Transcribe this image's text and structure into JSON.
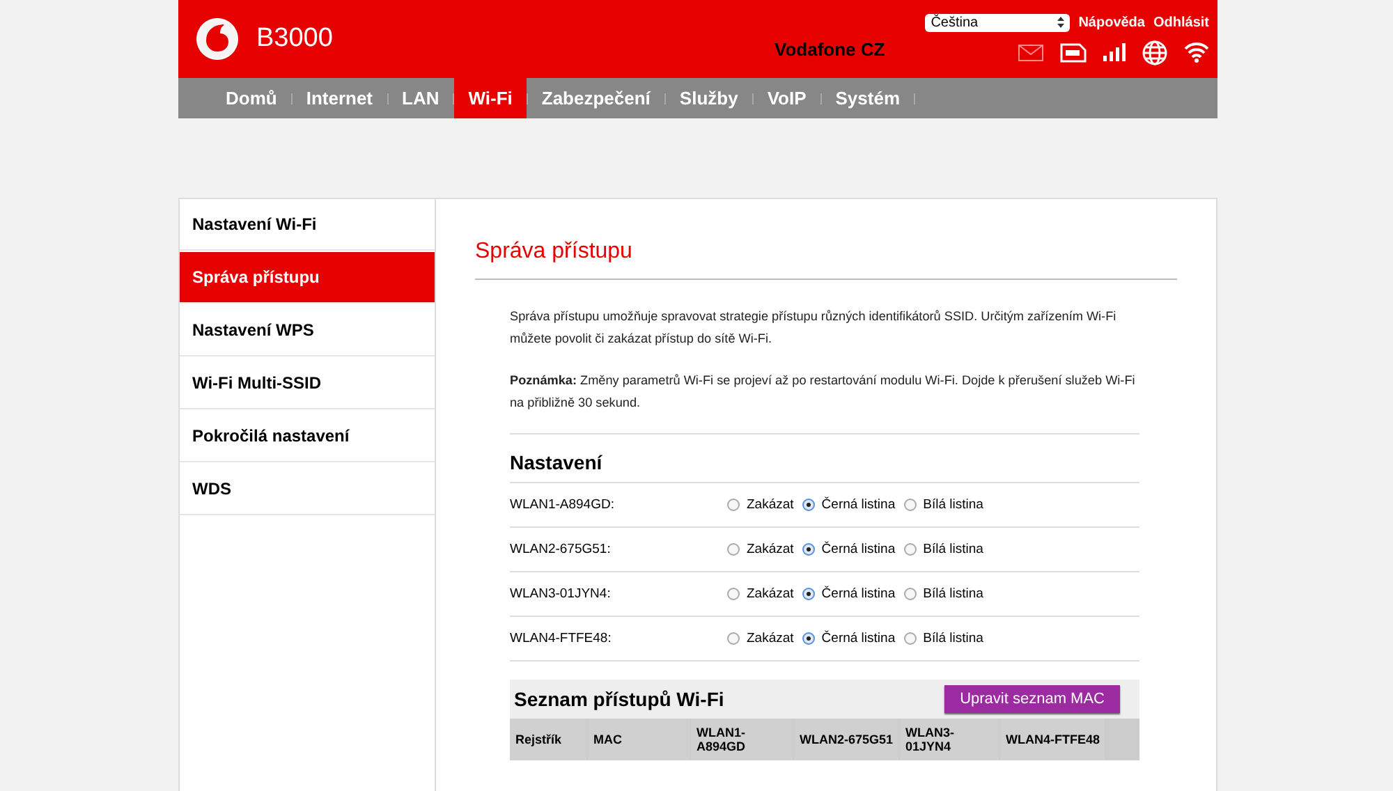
{
  "header": {
    "logo_text": "B3000",
    "language": "Čeština",
    "links": [
      "Nápověda",
      "Odhlásit"
    ],
    "operator": "Vodafone CZ"
  },
  "nav": [
    {
      "label": "Domů",
      "selected": false
    },
    {
      "label": "Internet",
      "selected": false
    },
    {
      "label": "LAN",
      "selected": false
    },
    {
      "label": "Wi-Fi",
      "selected": true
    },
    {
      "label": "Zabezpečení",
      "selected": false
    },
    {
      "label": "Služby",
      "selected": false
    },
    {
      "label": "VoIP",
      "selected": false
    },
    {
      "label": "Systém",
      "selected": false
    }
  ],
  "sidebar": {
    "items": [
      {
        "label": "Nastavení Wi-Fi",
        "selected": false
      },
      {
        "label": "Správa přístupu",
        "selected": true
      },
      {
        "label": "Nastavení WPS",
        "selected": false
      },
      {
        "label": "Wi-Fi Multi-SSID",
        "selected": false
      },
      {
        "label": "Pokročilá nastavení",
        "selected": false
      },
      {
        "label": "WDS",
        "selected": false
      }
    ]
  },
  "content": {
    "title": "Správa přístupu",
    "description": "Správa přístupu umožňuje spravovat strategie přístupu různých identifikátorů SSID. Určitým zařízením Wi-Fi můžete povolit či zakázat přístup do sítě Wi-Fi.",
    "note": "**Poznámka:** Změny parametrů Wi-Fi se projeví až po restartování modulu Wi-Fi. Dojde k přerušení služeb Wi-Fi na přibližně 30 sekund.",
    "settings": {
      "title": "Nastavení",
      "rows": [
        {
          "label": "WLAN1-A894GD:",
          "options": [
            {
              "label": "Zakázat",
              "selected": false
            },
            {
              "label": "Černá listina",
              "selected": true
            },
            {
              "label": "Bílá listina",
              "selected": false
            }
          ]
        },
        {
          "label": "WLAN2-675G51:",
          "options": [
            {
              "label": "Zakázat",
              "selected": false
            },
            {
              "label": "Černá listina",
              "selected": true
            },
            {
              "label": "Bílá listina",
              "selected": false
            }
          ]
        },
        {
          "label": "WLAN3-01JYN4:",
          "options": [
            {
              "label": "Zakázat",
              "selected": false
            },
            {
              "label": "Černá listina",
              "selected": true
            },
            {
              "label": "Bílá listina",
              "selected": false
            }
          ]
        },
        {
          "label": "WLAN4-FTFE48:",
          "options": [
            {
              "label": "Zakázat",
              "selected": false
            },
            {
              "label": "Černá listina",
              "selected": true
            },
            {
              "label": "Bílá listina",
              "selected": false
            }
          ]
        }
      ]
    },
    "access_list": {
      "title": "Seznam přístupů Wi-Fi",
      "button": "Upravit seznam MAC",
      "columns": [
        "Rejstřík",
        "MAC",
        "WLAN1-A894GD",
        "WLAN2-675G51",
        "WLAN3-01JYN4",
        "WLAN4-FTFE48"
      ]
    }
  }
}
